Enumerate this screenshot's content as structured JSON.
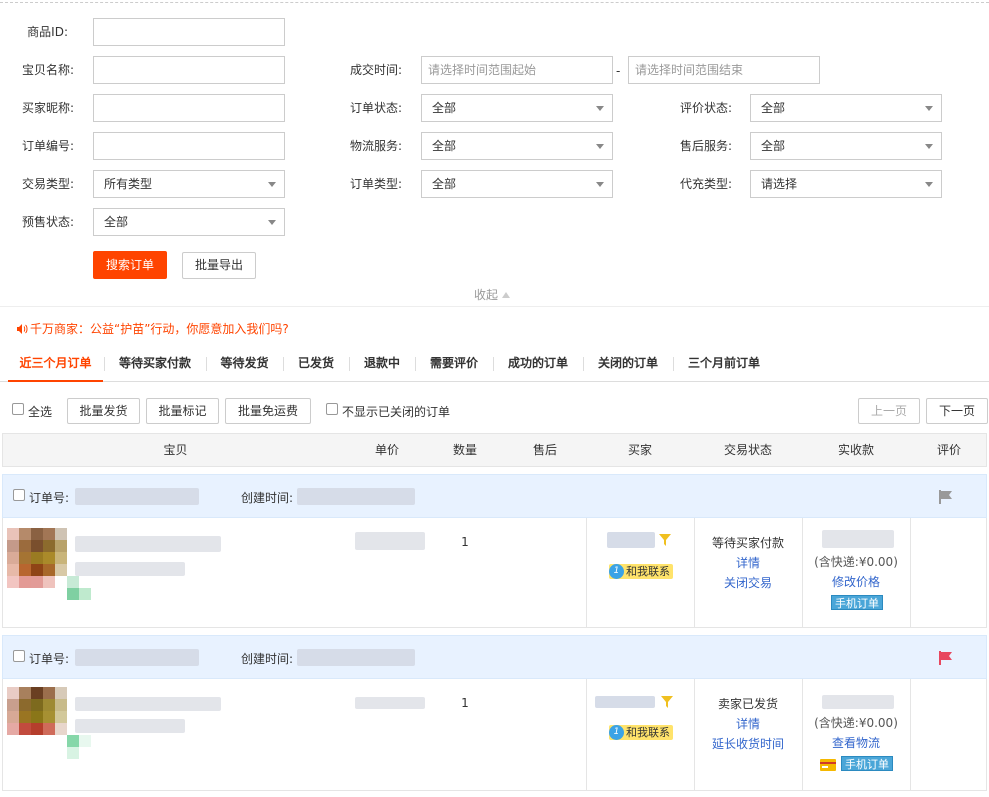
{
  "filters": {
    "product_id_label": "商品ID:",
    "item_name_label": "宝贝名称:",
    "buyer_nick_label": "买家昵称:",
    "order_no_label": "订单编号:",
    "trade_type_label": "交易类型:",
    "trade_type_value": "所有类型",
    "presale_label": "预售状态:",
    "presale_value": "全部",
    "deal_time_label": "成交时间:",
    "deal_time_start_placeholder": "请选择时间范围起始",
    "deal_time_sep": "-",
    "deal_time_end_placeholder": "请选择时间范围结束",
    "order_status_label": "订单状态:",
    "order_status_value": "全部",
    "logistics_label": "物流服务:",
    "logistics_value": "全部",
    "order_type_label": "订单类型:",
    "order_type_value": "全部",
    "review_status_label": "评价状态:",
    "review_status_value": "全部",
    "aftersale_label": "售后服务:",
    "aftersale_value": "全部",
    "recharge_type_label": "代充类型:",
    "recharge_type_value": "请选择",
    "search_button": "搜索订单",
    "export_button": "批量导出",
    "collapse_label": "收起"
  },
  "notice": "千万商家：公益“护苗”行动，你愿意加入我们吗?",
  "tabs": [
    {
      "label": "近三个月订单",
      "active": true
    },
    {
      "label": "等待买家付款"
    },
    {
      "label": "等待发货"
    },
    {
      "label": "已发货"
    },
    {
      "label": "退款中"
    },
    {
      "label": "需要评价"
    },
    {
      "label": "成功的订单"
    },
    {
      "label": "关闭的订单"
    },
    {
      "label": "三个月前订单"
    }
  ],
  "toolbar": {
    "select_all": "全选",
    "batch_ship": "批量发货",
    "batch_mark": "批量标记",
    "batch_free_ship": "批量免运费",
    "hide_closed": "不显示已关闭的订单",
    "prev_page": "上一页",
    "next_page": "下一页"
  },
  "table_headers": [
    "宝贝",
    "单价",
    "数量",
    "售后",
    "买家",
    "交易状态",
    "实收款",
    "评价"
  ],
  "orders": [
    {
      "order_no_label": "订单号:",
      "created_label": "创建时间:",
      "quantity": "1",
      "contact_label": "和我联系",
      "status": "等待买家付款",
      "links": [
        "详情",
        "关闭交易"
      ],
      "shipping_note": "(含快递:¥0.00)",
      "price_action": "修改价格",
      "mobile_badge": "手机订单",
      "flag_color": "#999999"
    },
    {
      "order_no_label": "订单号:",
      "created_label": "创建时间:",
      "quantity": "1",
      "contact_label": "和我联系",
      "status": "卖家已发货",
      "links": [
        "详情",
        "延长收货时间"
      ],
      "shipping_note": "(含快递:¥0.00)",
      "price_action": "查看物流",
      "mobile_badge": "手机订单",
      "flag_color": "#e8475f"
    }
  ]
}
